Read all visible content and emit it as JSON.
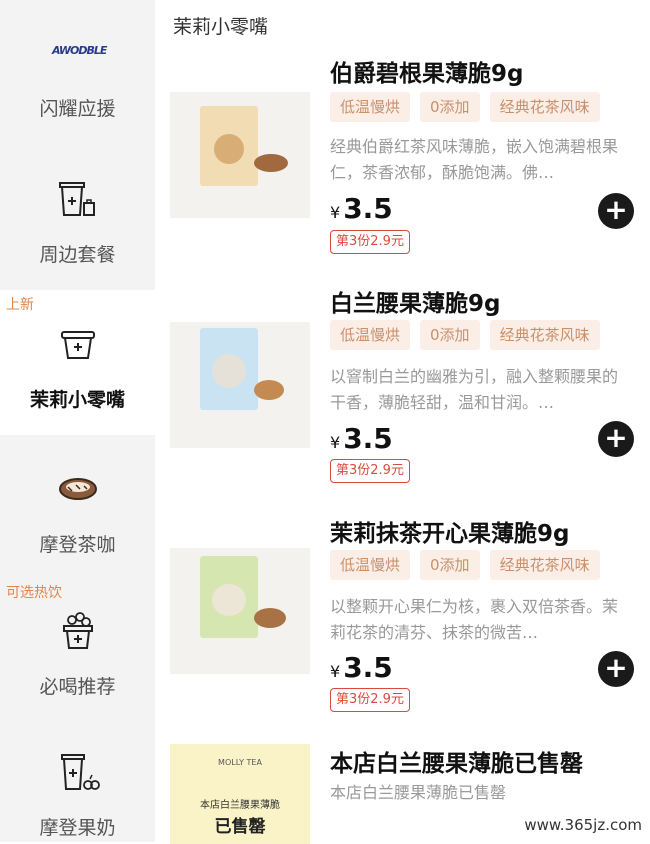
{
  "sidebar": {
    "items": [
      {
        "label": "闪耀应援",
        "logo_text": "AWODBLE"
      },
      {
        "label": "周边套餐"
      },
      {
        "label": "茉莉小零嘴",
        "badge": "上新"
      },
      {
        "label": "摩登茶咖"
      },
      {
        "label": "必喝推荐",
        "badge": "可选热饮"
      },
      {
        "label": "摩登果奶"
      }
    ]
  },
  "main": {
    "section_title": "茉莉小零嘴",
    "products": [
      {
        "name": "伯爵碧根果薄脆9g",
        "tags": [
          "低温慢烘",
          "0添加",
          "经典花茶风味"
        ],
        "desc": "经典伯爵红茶风味薄脆，嵌入饱满碧根果仁，茶香浓郁，酥脆饱满。佛…",
        "currency": "¥",
        "price": "3.5",
        "promo": "第3份2.9元",
        "pack_color": "#f2dcb3"
      },
      {
        "name": "白兰腰果薄脆9g",
        "tags": [
          "低温慢烘",
          "0添加",
          "经典花茶风味"
        ],
        "desc": "以窨制白兰的幽雅为引，融入整颗腰果的干香，薄脆轻甜，温和甘润。…",
        "currency": "¥",
        "price": "3.5",
        "promo": "第3份2.9元",
        "pack_color": "#c9e3f2"
      },
      {
        "name": "茉莉抹茶开心果薄脆9g",
        "tags": [
          "低温慢烘",
          "0添加",
          "经典花茶风味"
        ],
        "desc": "以整颗开心果仁为核，裹入双倍茶香。茉莉花茶的清芬、抹茶的微苦…",
        "currency": "¥",
        "price": "3.5",
        "promo": "第3份2.9元",
        "pack_color": "#d6e6b0"
      }
    ],
    "sold_out": {
      "name": "本店白兰腰果薄脆已售罄",
      "desc": "本店白兰腰果薄脆已售罄",
      "image_brand": "MOLLY TEA",
      "image_line1": "本店白兰腰果薄脆",
      "image_line2": "已售罄"
    }
  },
  "watermark": "www.365jz.com"
}
